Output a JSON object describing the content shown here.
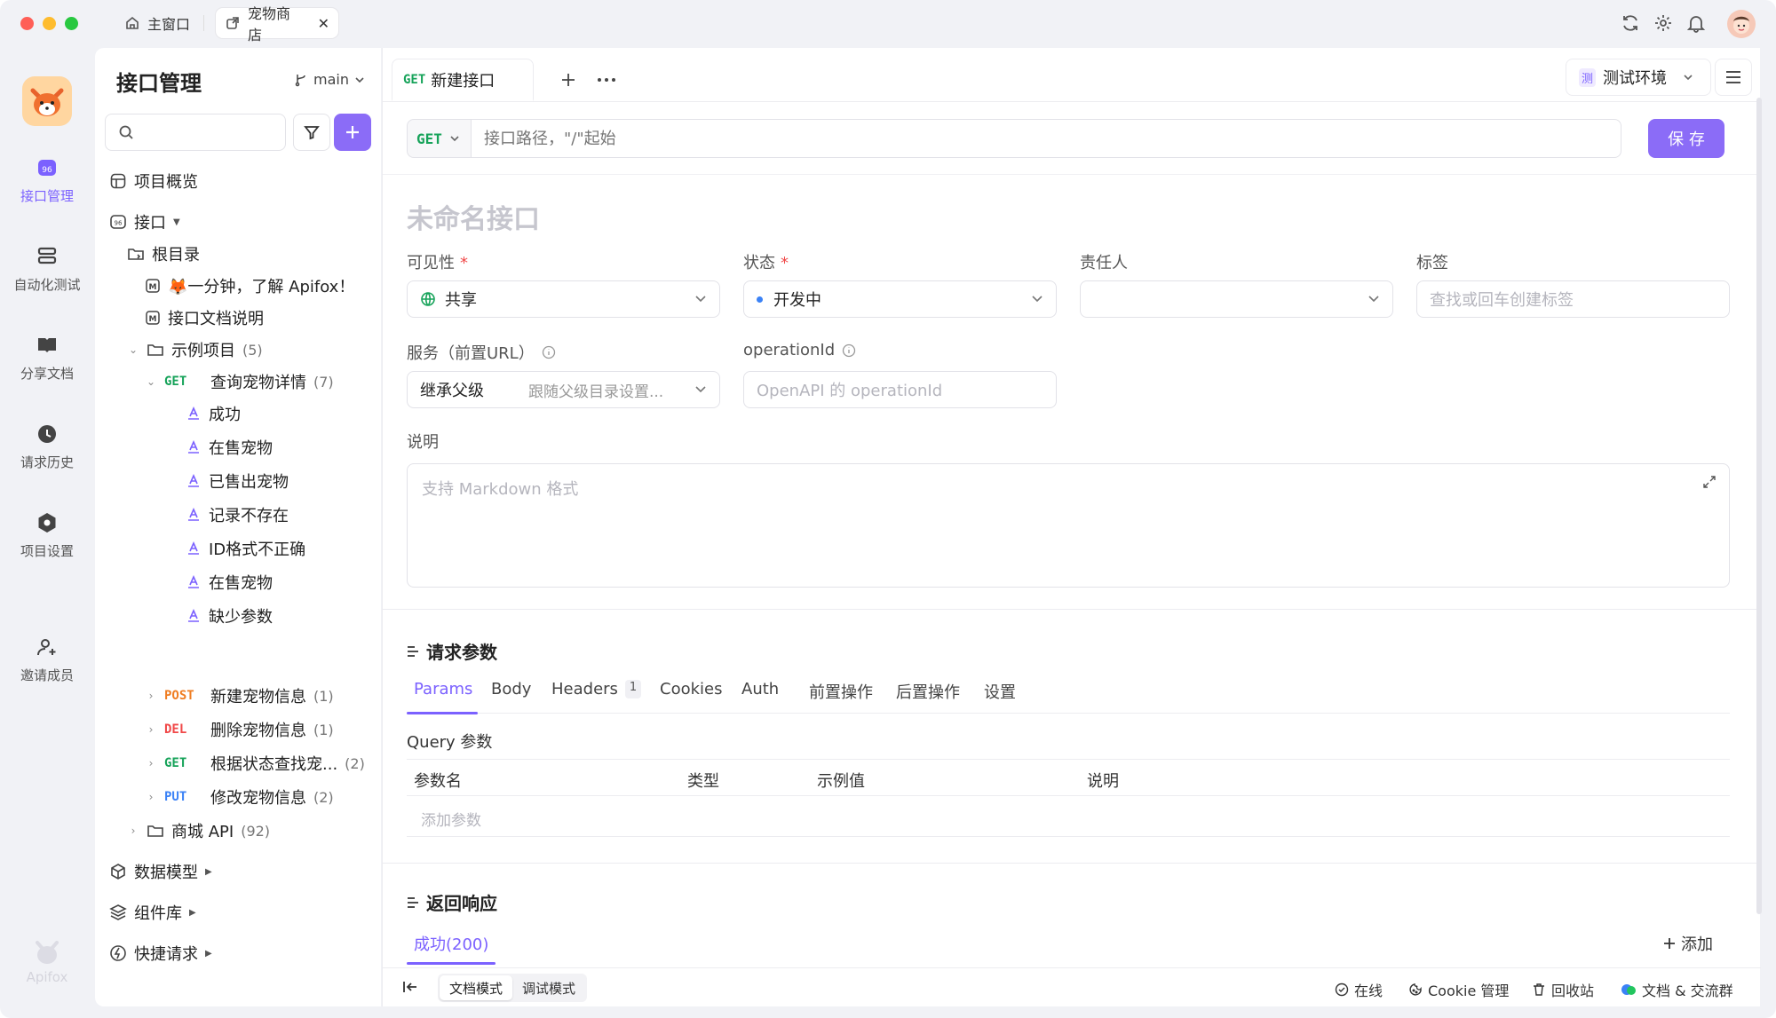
{
  "titlebar": {
    "tabs": [
      {
        "label": "主窗口",
        "icon": "home-icon"
      },
      {
        "label": "宠物商店",
        "icon": "external-window-icon"
      }
    ],
    "traffic_lights": [
      "#ff5f57",
      "#febc2e",
      "#28c840"
    ]
  },
  "rail": {
    "logo_text": "Apifox",
    "items": [
      {
        "label": "接口管理",
        "icon": "api-icon",
        "active": true
      },
      {
        "label": "自动化测试",
        "icon": "layers-icon"
      },
      {
        "label": "分享文档",
        "icon": "book-icon"
      },
      {
        "label": "请求历史",
        "icon": "clock-icon"
      },
      {
        "label": "项目设置",
        "icon": "settings-hex-icon"
      },
      {
        "label": "邀请成员",
        "icon": "add-user-icon"
      }
    ]
  },
  "sidebar": {
    "title": "接口管理",
    "branch": "main",
    "search_placeholder": "",
    "overview": "项目概览",
    "api_section": "接口",
    "root": "根目录",
    "docs": [
      {
        "label": "🦊一分钟，了解 Apifox！"
      },
      {
        "label": "接口文档说明"
      }
    ],
    "folder": {
      "label": "示例项目",
      "count": "(5)"
    },
    "endpoint_open": {
      "method": "GET",
      "label": "查询宠物详情",
      "count": "(7)"
    },
    "cases": [
      "成功",
      "在售宠物",
      "已售出宠物",
      "记录不存在",
      "ID格式不正确",
      "在售宠物",
      "缺少参数"
    ],
    "endpoints": [
      {
        "method": "POST",
        "label": "新建宠物信息",
        "count": "(1)"
      },
      {
        "method": "DEL",
        "label": "删除宠物信息",
        "count": "(1)"
      },
      {
        "method": "GET",
        "label": "根据状态查找宠...",
        "count": "(2)"
      },
      {
        "method": "PUT",
        "label": "修改宠物信息",
        "count": "(2)"
      }
    ],
    "mall": {
      "label": "商城 API",
      "count": "(92)"
    },
    "bottom": [
      "数据模型",
      "组件库",
      "快捷请求"
    ]
  },
  "main": {
    "tab": {
      "method": "GET",
      "label": "新建接口"
    },
    "env": {
      "badge": "测",
      "label": "测试环境"
    },
    "method": "GET",
    "path_placeholder": "接口路径，\"/\"起始",
    "save_label": "保 存",
    "name_placeholder": "未命名接口",
    "labels": {
      "visibility": "可见性",
      "status": "状态",
      "owner": "责任人",
      "tags": "标签",
      "service": "服务（前置URL）",
      "operation_id": "operationId",
      "desc": "说明"
    },
    "required_mark": "*",
    "visibility_value": "共享",
    "status_value": "开发中",
    "tags_placeholder": "查找或回车创建标签",
    "service_value": "继承父级",
    "service_hint": "跟随父级目录设置...",
    "operation_placeholder": "OpenAPI 的 operationId",
    "desc_placeholder": "支持 Markdown 格式",
    "request": {
      "title": "请求参数",
      "tabs": [
        "Params",
        "Body",
        "Headers",
        "Cookies",
        "Auth",
        "前置操作",
        "后置操作",
        "设置"
      ],
      "headers_count": "1",
      "query_title": "Query 参数",
      "columns": [
        "参数名",
        "类型",
        "示例值",
        "说明"
      ],
      "add_placeholder": "添加参数"
    },
    "response": {
      "title": "返回响应",
      "tab": "成功(200)",
      "add": "添加"
    }
  },
  "footer": {
    "modes": [
      "文档模式",
      "调试模式"
    ],
    "items": [
      "在线",
      "Cookie 管理",
      "回收站",
      "文档 & 交流群"
    ]
  },
  "colors": {
    "accent": "#7b61ff",
    "get": "#17a35a",
    "post": "#ef7d22",
    "del": "#f04848",
    "put": "#3b82f6"
  }
}
